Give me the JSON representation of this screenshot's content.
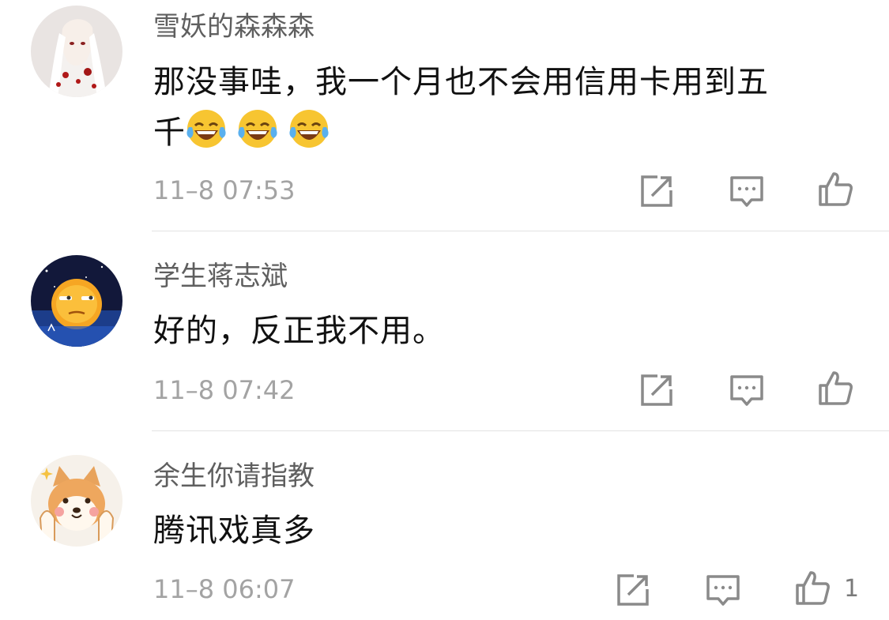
{
  "comments": [
    {
      "author": "雪妖的森森森",
      "text_line1": "那没事哇，我一个月也不会用信用卡用到五",
      "text_line2": "千",
      "emojis": [
        "laugh-cry-emoji",
        "laugh-cry-emoji",
        "laugh-cry-emoji"
      ],
      "time": "11–8 07:53",
      "like_count": ""
    },
    {
      "author": "学生蒋志斌",
      "text_line1": "好的，反正我不用。",
      "time": "11–8 07:42",
      "like_count": ""
    },
    {
      "author": "余生你请指教",
      "text_line1": "腾讯戏真多",
      "time": "11–8 06:07",
      "like_count": "1"
    }
  ],
  "icons": {
    "share": "share-icon",
    "reply": "comment-icon",
    "like": "thumbs-up-icon"
  },
  "colors": {
    "name": "#5f5f5f",
    "text": "#111111",
    "time": "#a3a3a3",
    "icon": "#8a8a8a",
    "divider": "#e3e3e3"
  }
}
